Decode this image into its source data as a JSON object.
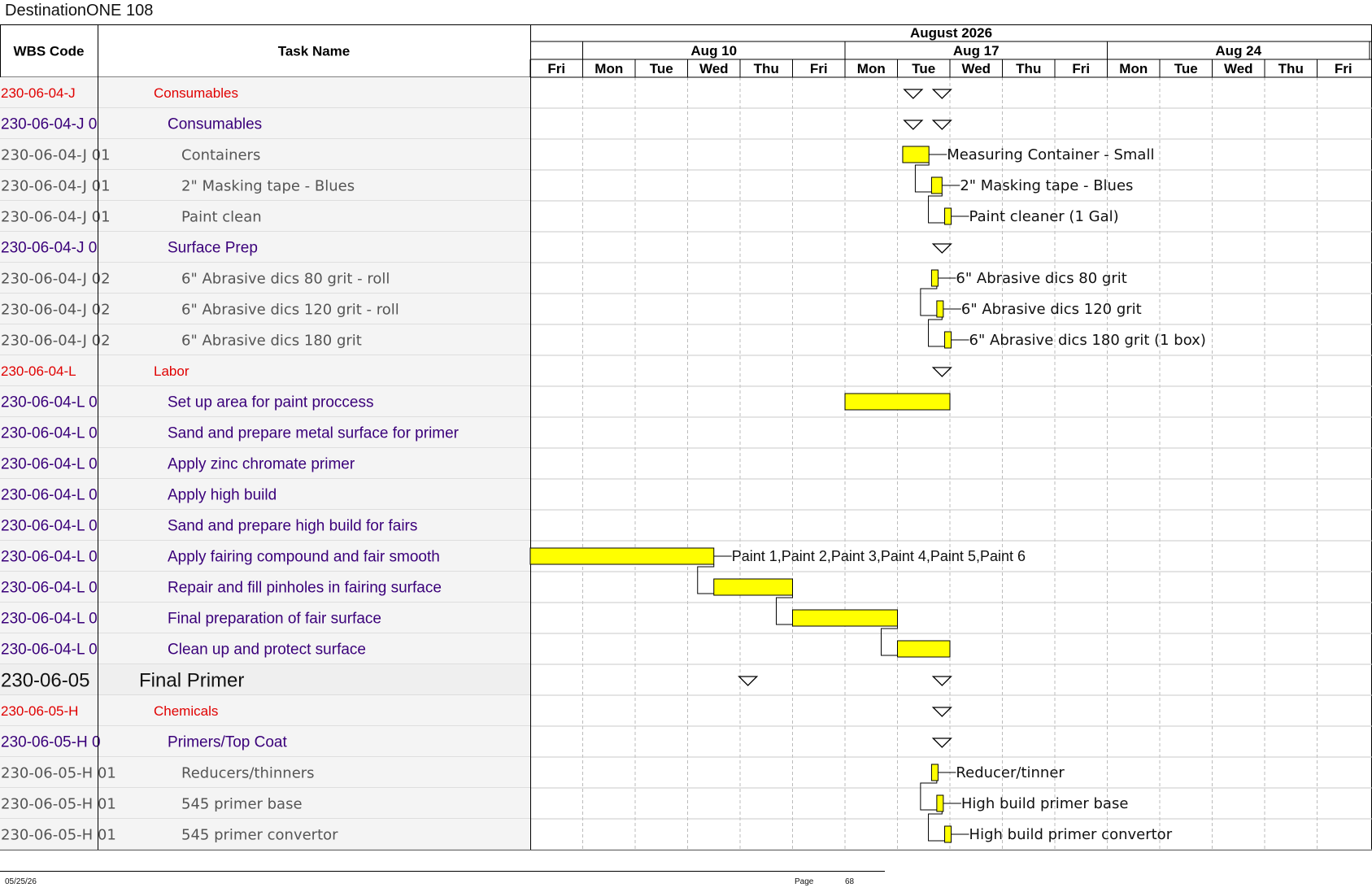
{
  "document": {
    "title": "DestinationONE 108"
  },
  "header": {
    "wbs_label": "WBS Code",
    "task_label": "Task Name",
    "month": "August 2026",
    "weeks": [
      "Aug 10",
      "Aug 17",
      "Aug 24"
    ],
    "days": [
      "Fri",
      "Mon",
      "Tue",
      "Wed",
      "Thu",
      "Fri",
      "Mon",
      "Tue",
      "Wed",
      "Thu",
      "Fri",
      "Mon",
      "Tue",
      "Wed",
      "Thu",
      "Fri"
    ]
  },
  "rows": [
    {
      "wbs": "230-06-04-J",
      "task": "Consumables",
      "level": 1,
      "color": "#e00000"
    },
    {
      "wbs": "230-06-04-J 0",
      "task": "Consumables",
      "level": 2,
      "color": "#3a007a"
    },
    {
      "wbs": "230-06-04-J 01",
      "task": "Containers",
      "level": 3,
      "color": "#555555"
    },
    {
      "wbs": "230-06-04-J 01",
      "task": "2\" Masking tape - Blues",
      "level": 3,
      "color": "#555555"
    },
    {
      "wbs": "230-06-04-J 01",
      "task": "Paint clean",
      "level": 3,
      "color": "#555555"
    },
    {
      "wbs": "230-06-04-J 0",
      "task": "Surface Prep",
      "level": 2,
      "color": "#3a007a"
    },
    {
      "wbs": "230-06-04-J 02",
      "task": "6\" Abrasive dics 80 grit - roll",
      "level": 3,
      "color": "#555555"
    },
    {
      "wbs": "230-06-04-J 02",
      "task": "6\" Abrasive dics 120 grit - roll",
      "level": 3,
      "color": "#555555"
    },
    {
      "wbs": "230-06-04-J 02",
      "task": "6\" Abrasive dics 180 grit",
      "level": 3,
      "color": "#555555"
    },
    {
      "wbs": "230-06-04-L",
      "task": "Labor",
      "level": 1,
      "color": "#e00000"
    },
    {
      "wbs": "230-06-04-L 0",
      "task": "Set up area for paint proccess",
      "level": 2,
      "color": "#3a007a"
    },
    {
      "wbs": "230-06-04-L 0",
      "task": "Sand and prepare metal surface for primer",
      "level": 2,
      "color": "#3a007a"
    },
    {
      "wbs": "230-06-04-L 0",
      "task": "Apply zinc chromate primer",
      "level": 2,
      "color": "#3a007a"
    },
    {
      "wbs": "230-06-04-L 0",
      "task": "Apply high build",
      "level": 2,
      "color": "#3a007a"
    },
    {
      "wbs": "230-06-04-L 0",
      "task": "Sand and prepare high build for fairs",
      "level": 2,
      "color": "#3a007a"
    },
    {
      "wbs": "230-06-04-L 0",
      "task": "Apply fairing compound and fair smooth",
      "level": 2,
      "color": "#3a007a"
    },
    {
      "wbs": "230-06-04-L 0",
      "task": "Repair and fill pinholes in fairing surface",
      "level": 2,
      "color": "#3a007a"
    },
    {
      "wbs": "230-06-04-L 0",
      "task": "Final preparation of fair surface",
      "level": 2,
      "color": "#3a007a"
    },
    {
      "wbs": "230-06-04-L 0",
      "task": "Clean up and protect surface",
      "level": 2,
      "color": "#3a007a"
    },
    {
      "wbs": "230-06-05",
      "task": "Final Primer",
      "level": 0,
      "color": "#111111"
    },
    {
      "wbs": "230-06-05-H",
      "task": "Chemicals",
      "level": 1,
      "color": "#e00000"
    },
    {
      "wbs": "230-06-05-H 0",
      "task": "Primers/Top Coat",
      "level": 2,
      "color": "#3a007a"
    },
    {
      "wbs": "230-06-05-H 01",
      "task": "Reducers/thinners",
      "level": 3,
      "color": "#555555"
    },
    {
      "wbs": "230-06-05-H 01",
      "task": "545 primer base",
      "level": 3,
      "color": "#555555"
    },
    {
      "wbs": "230-06-05-H 01",
      "task": "545 primer convertor",
      "level": 3,
      "color": "#555555"
    }
  ],
  "bars": [
    {
      "row": 2,
      "start": 7.1,
      "end": 7.6,
      "label": "Measuring Container - Small"
    },
    {
      "row": 3,
      "start": 7.65,
      "end": 7.85,
      "label": "2\" Masking tape - Blues"
    },
    {
      "row": 4,
      "start": 7.9,
      "end": 8.0,
      "label": "Paint cleaner (1 Gal)"
    },
    {
      "row": 6,
      "start": 7.65,
      "end": 7.75,
      "label": "6\" Abrasive dics 80 grit"
    },
    {
      "row": 7,
      "start": 7.75,
      "end": 7.85,
      "label": "6\" Abrasive dics 120 grit"
    },
    {
      "row": 8,
      "start": 7.9,
      "end": 8.0,
      "label": "6\" Abrasive dics 180 grit (1 box)"
    },
    {
      "row": 10,
      "start": 6.0,
      "end": 8.0,
      "label": ""
    },
    {
      "row": 15,
      "start": 0.0,
      "end": 3.5,
      "label": "Paint 1,Paint 2,Paint 3,Paint 4,Paint 5,Paint 6"
    },
    {
      "row": 16,
      "start": 3.5,
      "end": 5.0,
      "label": ""
    },
    {
      "row": 17,
      "start": 5.0,
      "end": 7.0,
      "label": ""
    },
    {
      "row": 18,
      "start": 7.0,
      "end": 8.0,
      "label": ""
    },
    {
      "row": 23,
      "start": 7.75,
      "end": 7.85,
      "label": "High build primer base"
    },
    {
      "row": 22,
      "start": 7.65,
      "end": 7.75,
      "label": "Reducer/tinner"
    },
    {
      "row": 24,
      "start": 7.9,
      "end": 8.0,
      "label": "High build primer convertor"
    }
  ],
  "summaries": [
    {
      "row": 0,
      "marks": [
        7.3,
        7.85
      ]
    },
    {
      "row": 1,
      "marks": [
        7.3,
        7.85
      ]
    },
    {
      "row": 5,
      "marks": [
        7.85
      ]
    },
    {
      "row": 9,
      "marks": [
        7.85
      ]
    },
    {
      "row": 19,
      "marks": [
        4.15,
        7.85
      ]
    },
    {
      "row": 20,
      "marks": [
        7.85
      ]
    },
    {
      "row": 21,
      "marks": [
        7.85
      ]
    }
  ],
  "links": [
    {
      "from": 2,
      "to": 3
    },
    {
      "from": 3,
      "to": 4
    },
    {
      "from": 6,
      "to": 7
    },
    {
      "from": 7,
      "to": 8
    },
    {
      "from": 15,
      "to": 16
    },
    {
      "from": 16,
      "to": 17
    },
    {
      "from": 17,
      "to": 18
    },
    {
      "from": 22,
      "to": 23
    },
    {
      "from": 23,
      "to": 24
    }
  ],
  "footer": {
    "date": "05/25/26",
    "page_label": "Page",
    "page_number": "68"
  }
}
